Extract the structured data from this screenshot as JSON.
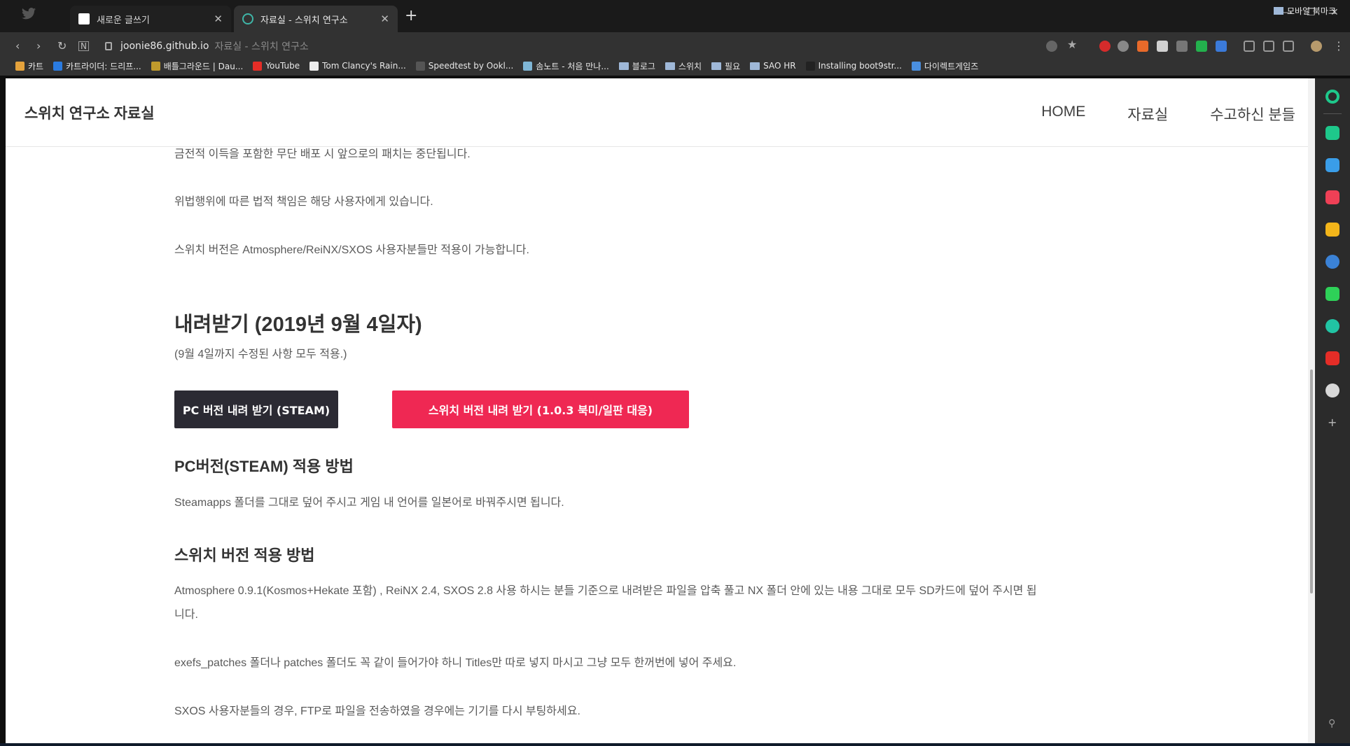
{
  "tabs": [
    {
      "title": "새로운 글쓰기",
      "active": false
    },
    {
      "title": "자료실 - 스위치 연구소",
      "active": true
    }
  ],
  "toolbar": {
    "host": "joonie86.github.io",
    "page_title": "자료실 - 스위치 연구소"
  },
  "bookmarks": [
    {
      "label": "카트",
      "icon": "kart-icon",
      "color": "#e4a23c"
    },
    {
      "label": "카트라이더: 드리프...",
      "icon": "kartrider-icon",
      "color": "#2a7be0"
    },
    {
      "label": "배틀그라운드 | Dau...",
      "icon": "pubg-icon",
      "color": "#c09a2c"
    },
    {
      "label": "YouTube",
      "icon": "youtube-icon",
      "color": "#e52d27"
    },
    {
      "label": "Tom Clancy's Rain...",
      "icon": "rainbow-six-icon",
      "color": "#eeeeee"
    },
    {
      "label": "Speedtest by Ookl...",
      "icon": "speedtest-icon",
      "color": "#555555"
    },
    {
      "label": "솜노트 - 처음 만나...",
      "icon": "somnote-icon",
      "color": "#7fb6d6"
    },
    {
      "label": "블로그",
      "icon": "folder-icon",
      "folder": true
    },
    {
      "label": "스위치",
      "icon": "folder-icon",
      "folder": true
    },
    {
      "label": "필요",
      "icon": "folder-icon",
      "folder": true
    },
    {
      "label": "SAO HR",
      "icon": "folder-icon",
      "folder": true
    },
    {
      "label": "Installing boot9str...",
      "icon": "github-icon",
      "color": "#222222"
    },
    {
      "label": "다이렉트게임즈",
      "icon": "directgames-icon",
      "color": "#4a8fe0"
    }
  ],
  "bookmarks_right": "모바일 북마크",
  "site": {
    "brand": "스위치 연구소 자료실",
    "menu": [
      "HOME",
      "자료실",
      "수고하신 분들"
    ]
  },
  "article": {
    "p1": "금전적 이득을 포함한 무단 배포 시 앞으로의 패치는 중단됩니다.",
    "p2": "위법행위에 따른 법적 책임은 해당 사용자에게 있습니다.",
    "p3": "스위치 버전은 Atmosphere/ReiNX/SXOS 사용자분들만 적용이 가능합니다.",
    "download_heading": "내려받기 (2019년 9월 4일자)",
    "download_note": "(9월 4일까지 수정된 사항 모두 적용.)",
    "btn_pc": "PC 버전 내려 받기 (STEAM)",
    "btn_switch": "스위치 버전 내려 받기 (1.0.3 북미/일판 대응)",
    "pc_heading": "PC버전(STEAM) 적용 방법",
    "pc_text": "Steamapps 폴더를 그대로 덮어 주시고 게임 내 언어를 일본어로 바꿔주시면 됩니다.",
    "switch_heading": "스위치 버전 적용 방법",
    "switch_text_1": "Atmosphere 0.9.1(Kosmos+Hekate 포함) , ReiNX 2.4, SXOS 2.8 사용 하시는 분들 기준으로 내려받은 파일을 압축 풀고 NX 폴더 안에 있는 내용 그대로 모두 SD카드에 덮어 주시면 됩",
    "switch_text_1b": "니다.",
    "switch_text_2": "exefs_patches 폴더나 patches 폴더도 꼭 같이 들어가야 하니 Titles만 따로 넣지 마시고 그냥 모두 한꺼번에 넣어 주세요.",
    "switch_text_3": "SXOS 사용자분들의 경우, FTP로 파일을 전송하였을 경우에는 기기를 다시 부팅하세요."
  },
  "colors": {
    "btn_pc": "#2b2a33",
    "btn_switch": "#ef2853"
  }
}
